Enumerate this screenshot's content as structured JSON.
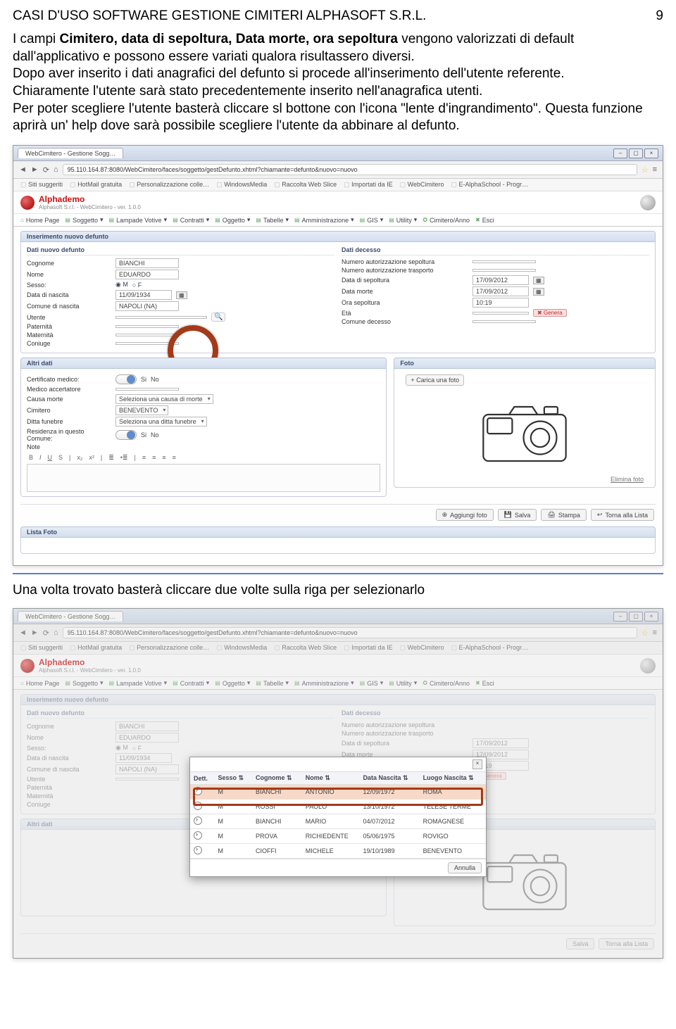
{
  "header": {
    "title": "CASI  D'USO SOFTWARE GESTIONE CIMITERI ALPHASOFT S.R.L.",
    "page": "9"
  },
  "para": {
    "p1a": "I campi ",
    "p1b": "Cimitero, data di sepoltura, Data morte, ora sepoltura",
    "p1c": " vengono valorizzati di default dall'applicativo e possono essere variati qualora risultassero diversi.",
    "p2": "Dopo aver inserito i dati anagrafici del defunto si procede all'inserimento dell'utente referente.",
    "p3": "Chiaramente l'utente sarà stato precedentemente inserito nell'anagrafica utenti.",
    "p4": "Per poter scegliere l'utente basterà cliccare sl bottone con l'icona \"lente d'ingrandimento\". Questa funzione aprirà un' help dove sarà possibile scegliere l'utente da abbinare al defunto."
  },
  "mid": "Una volta trovato basterà cliccare due volte sulla riga per selezionarlo",
  "browser": {
    "tab": "WebCimitero - Gestione Sogg…",
    "url": "95.110.164.87:8080/WebCimitero/faces/soggetto/gestDefunto.xhtml?chiamante=defunto&nuovo=nuovo",
    "bookmarks": [
      "Siti suggeriti",
      "HotMail gratuita",
      "Personalizzazione colle…",
      "WindowsMedia",
      "Raccolta Web Slice",
      "Importati da IE",
      "WebCimitero",
      "E-AlphaSchool - Progr…"
    ]
  },
  "brand": {
    "name": "Alphademo",
    "sub": "Alphasoft S.r.l. - WebCimitero - ver. 1.0.0"
  },
  "menu": [
    "Home Page",
    "Soggetto",
    "Lampade Votive",
    "Contratti",
    "Oggetto",
    "Tabelle",
    "Amministrazione",
    "GIS",
    "Utility",
    "Cimitero/Anno",
    "Esci"
  ],
  "sections": {
    "insert": "Inserimento nuovo defunto",
    "defunto": "Dati nuovo defunto",
    "decesso": "Dati decesso",
    "altri": "Altri dati",
    "foto": "Foto",
    "lista": "Lista Foto"
  },
  "defunto": {
    "cognome_l": "Cognome",
    "cognome_v": "BIANCHI",
    "nome_l": "Nome",
    "nome_v": "EDUARDO",
    "sesso_l": "Sesso:",
    "sesso_m": "M",
    "sesso_f": "F",
    "nascita_l": "Data di nascita",
    "nascita_v": "11/09/1934",
    "comune_l": "Comune di nascita",
    "comune_v": "NAPOLI (NA)",
    "utente_l": "Utente",
    "paternita_l": "Paternità",
    "maternita_l": "Maternità",
    "coniuge_l": "Coniuge"
  },
  "decesso": {
    "autsep_l": "Numero autorizzazione sepoltura",
    "auttra_l": "Numero autorizzazione trasporto",
    "datasep_l": "Data di sepoltura",
    "datasep_v": "17/09/2012",
    "datamor_l": "Data morte",
    "datamor_v": "17/09/2012",
    "orasep_l": "Ora sepoltura",
    "orasep_v": "10:19",
    "eta_l": "Età",
    "genera": "Genera",
    "comdec_l": "Comune decesso"
  },
  "altri": {
    "cert_l": "Certificato medico:",
    "si": "Si",
    "no": "No",
    "medico_l": "Medico accertatore",
    "causa_l": "Causa morte",
    "causa_v": "Seleziona una causa di morte",
    "cimitero_l": "Cimitero",
    "cimitero_v": "BENEVENTO",
    "ditta_l": "Ditta funebre",
    "ditta_v": "Seleziona una ditta funebre",
    "residenza_l": "Residenza in questo Comune:",
    "note_l": "Note"
  },
  "foto": {
    "carica": "+ Carica una foto",
    "elimina": "Elimina foto"
  },
  "buttons": {
    "aggiungi": "Aggiungi foto",
    "salva": "Salva",
    "stampa": "Stampa",
    "lista": "Torna alla Lista"
  },
  "popup": {
    "cols": {
      "dett": "Dett.",
      "sesso": "Sesso",
      "cognome": "Cognome",
      "nome": "Nome",
      "data": "Data Nascita",
      "luogo": "Luogo Nascita"
    },
    "rows": [
      {
        "s": "M",
        "c": "BIANCHI",
        "n": "ANTONIO",
        "d": "12/09/1972",
        "l": "ROMA"
      },
      {
        "s": "M",
        "c": "ROSSI",
        "n": "PAOLO",
        "d": "13/10/1972",
        "l": "TELESE TERME"
      },
      {
        "s": "M",
        "c": "BIANCHI",
        "n": "MARIO",
        "d": "04/07/2012",
        "l": "ROMAGNESE"
      },
      {
        "s": "M",
        "c": "PROVA",
        "n": "RICHIEDENTE",
        "d": "05/06/1975",
        "l": "ROVIGO"
      },
      {
        "s": "M",
        "c": "CIOFFI",
        "n": "MICHELE",
        "d": "19/10/1989",
        "l": "BENEVENTO"
      }
    ],
    "annulla": "Annulla"
  }
}
